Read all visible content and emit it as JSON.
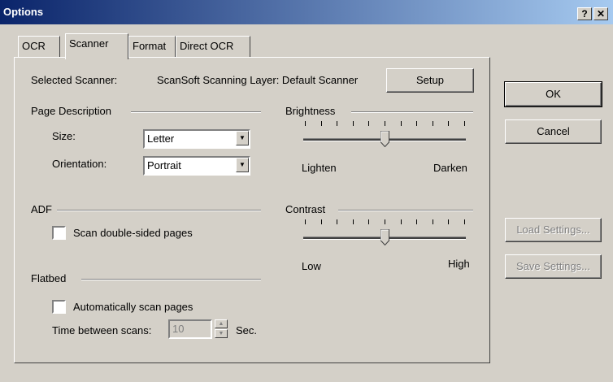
{
  "window": {
    "title": "Options"
  },
  "tabs": [
    "OCR",
    "Scanner",
    "Format",
    "Direct OCR"
  ],
  "scanner": {
    "label": "Selected Scanner:",
    "value": "ScanSoft Scanning Layer: Default Scanner",
    "setup_label": "Setup"
  },
  "page_description": {
    "group_label": "Page Description",
    "size_label": "Size:",
    "size_value": "Letter",
    "orientation_label": "Orientation:",
    "orientation_value": "Portrait"
  },
  "adf": {
    "group_label": "ADF",
    "double_sided_label": "Scan double-sided pages",
    "double_sided_checked": false
  },
  "flatbed": {
    "group_label": "Flatbed",
    "auto_scan_label": "Automatically scan pages",
    "auto_scan_checked": false,
    "time_label": "Time between scans:",
    "time_value": "10",
    "time_unit": "Sec."
  },
  "brightness": {
    "group_label": "Brightness",
    "min_label": "Lighten",
    "max_label": "Darken",
    "level": 0.5
  },
  "contrast": {
    "group_label": "Contrast",
    "min_label": "Low",
    "max_label": "High",
    "level": 0.5
  },
  "buttons": {
    "ok": "OK",
    "cancel": "Cancel",
    "load": "Load Settings...",
    "save": "Save Settings..."
  },
  "colors": {
    "titlebar_start": "#0a246a",
    "titlebar_end": "#a6caf0",
    "face": "#d4d0c8"
  }
}
